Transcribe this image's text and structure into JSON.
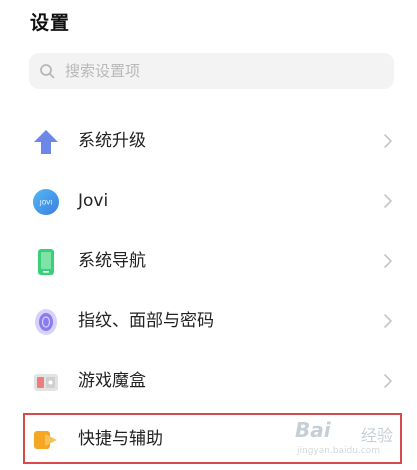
{
  "header": {
    "title": "设置"
  },
  "search": {
    "placeholder": "搜索设置项"
  },
  "items": [
    {
      "label": "系统升级"
    },
    {
      "label": "Jovi",
      "icon_text": "JOVI"
    },
    {
      "label": "系统导航"
    },
    {
      "label": "指纹、面部与密码"
    },
    {
      "label": "游戏魔盒"
    },
    {
      "label": "快捷与辅助"
    }
  ],
  "watermark": {
    "logo": "Bai",
    "text": "经验",
    "url": "jingyan.baidu.com"
  },
  "colors": {
    "highlight": "#d9484a",
    "background": "#ffffff"
  }
}
